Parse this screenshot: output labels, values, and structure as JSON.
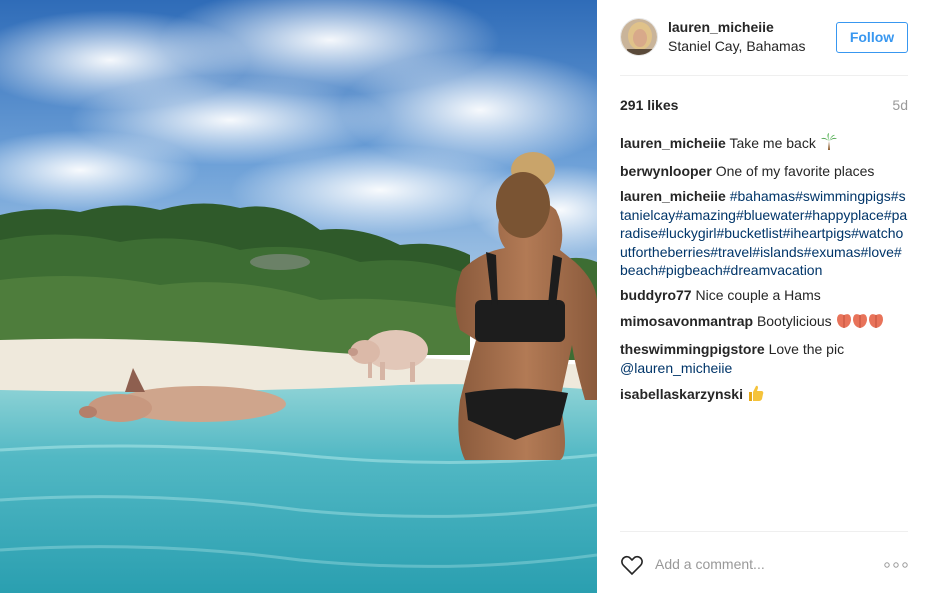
{
  "post": {
    "username": "lauren_micheiie",
    "location": "Staniel Cay, Bahamas",
    "follow_label": "Follow",
    "likes": "291 likes",
    "age": "5d"
  },
  "comments": [
    {
      "author": "lauren_micheiie",
      "text": "Take me back",
      "emoji": "palm-tree-icon"
    },
    {
      "author": "berwynlooper",
      "text": "One of my favorite places"
    },
    {
      "author": "lauren_micheiie",
      "tags": "#bahamas#swimmingpigs#stanielcay#amazing#bluewater#happyplace#paradise#luckygirl#bucketlist#iheartpigs#watchoutfortheberries#travel#islands#exumas#love#beach#pigbeach#dreamvacation"
    },
    {
      "author": "buddyro77",
      "text": "Nice couple a Hams"
    },
    {
      "author": "mimosavonmantrap",
      "text": "Bootylicious",
      "emoji": "three-peaches-icon"
    },
    {
      "author": "theswimmingpigstore",
      "text": "Love the pic",
      "mention": "@lauren_micheiie"
    },
    {
      "author": "isabellaskarzynski",
      "text": "",
      "emoji": "thumbs-up-icon"
    }
  ],
  "footer": {
    "comment_placeholder": "Add a comment..."
  },
  "colors": {
    "accent": "#3897f0",
    "hashtag": "#003569",
    "muted": "#999999"
  }
}
